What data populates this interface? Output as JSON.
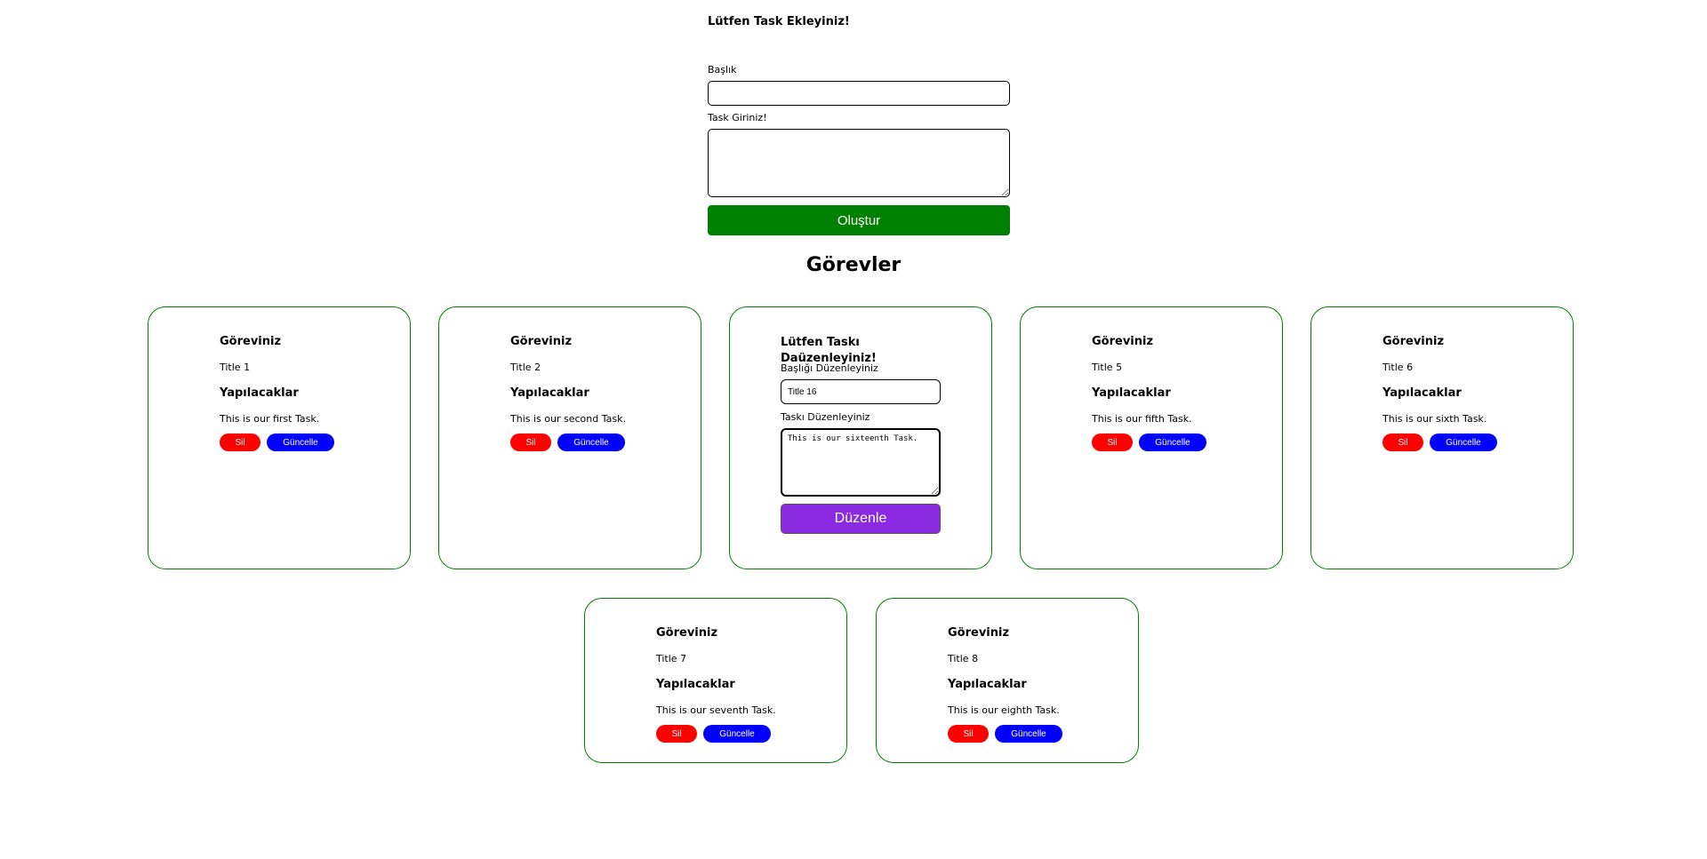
{
  "add_form": {
    "title": "Lütfen Task Ekleyiniz!",
    "title_label": "Başlık",
    "title_value": "",
    "task_label": "Task Giriniz!",
    "task_value": "",
    "submit_label": "Oluştur"
  },
  "tasks_heading": "Görevler",
  "card_labels": {
    "task_heading": "Göreviniz",
    "todo_heading": "Yapılacaklar",
    "delete": "Sil",
    "update": "Güncelle"
  },
  "cards": [
    {
      "title": "Title 1",
      "task": "This is our first Task."
    },
    {
      "title": "Title 2",
      "task": "This is our second Task."
    },
    {
      "title": "Title 5",
      "task": "This is our fifth Task."
    },
    {
      "title": "Title 6",
      "task": "This is our sixth Task."
    },
    {
      "title": "Title 7",
      "task": "This is our seventh Task."
    },
    {
      "title": "Title 8",
      "task": "This is our eighth Task."
    }
  ],
  "edit_card": {
    "title": "Lütfen Taskı Daüzenleyiniz!",
    "title_label": "Başlığı Düzenleyiniz",
    "title_value": "Title 16",
    "task_label": "Taskı Düzenleyiniz",
    "task_value": "This is our sixteenth Task.",
    "submit_label": "Düzenle"
  },
  "colors": {
    "create_button": "#008000",
    "card_border": "#008000",
    "delete_button": "#ff0000",
    "update_button": "#0000ff",
    "edit_button": "#8a2be2"
  }
}
